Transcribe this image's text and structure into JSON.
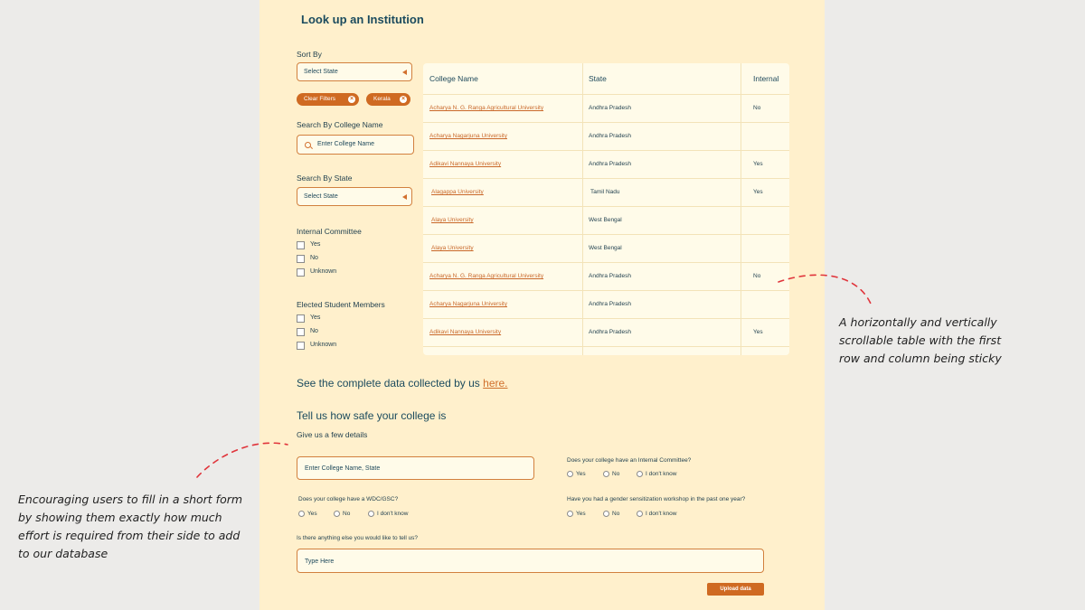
{
  "page": {
    "title": "Look up an Institution",
    "sort_by_label": "Sort By",
    "sort_select": "Select State",
    "chips": [
      {
        "label": "Clear Filters"
      },
      {
        "label": "Kerala"
      }
    ],
    "search_name_label": "Search By College Name",
    "search_name_placeholder": "Enter College Name",
    "search_state_label": "Search By State",
    "state_select": "Select State",
    "internal_committee_label": "Internal Committee",
    "internal_committee_options": [
      "Yes",
      "No",
      "Unknown"
    ],
    "elected_label": "Elected Student Members",
    "elected_options": [
      "Yes",
      "No",
      "Unknown"
    ]
  },
  "table": {
    "headers": [
      "College Name",
      "State",
      "Internal"
    ],
    "rows": [
      {
        "name": "Acharya N. G. Ranga Agricultural University",
        "state": "Andhra Pradesh",
        "internal": "No"
      },
      {
        "name": "Acharya Nagarjuna University",
        "state": "Andhra Pradesh",
        "internal": ""
      },
      {
        "name": "Adikavi Nannaya University",
        "state": "Andhra Pradesh",
        "internal": "Yes"
      },
      {
        "name": "Alagappa University",
        "state": "Tamil Nadu",
        "internal": "Yes"
      },
      {
        "name": "Alaya University",
        "state": "West Bengal",
        "internal": ""
      },
      {
        "name": "Alaya University",
        "state": "West Bengal",
        "internal": ""
      },
      {
        "name": "Acharya N. G. Ranga Agricultural University",
        "state": "Andhra Pradesh",
        "internal": "No"
      },
      {
        "name": "Acharya Nagarjuna University",
        "state": "Andhra Pradesh",
        "internal": ""
      },
      {
        "name": "Adikavi Nannaya University",
        "state": "Andhra Pradesh",
        "internal": "Yes"
      }
    ]
  },
  "complete_data": {
    "text": "See the complete data collected by us ",
    "link": "here."
  },
  "form": {
    "heading": "Tell us how safe your college is",
    "subheading": "Give us a few details",
    "college_placeholder": "Enter College Name, State",
    "q_internal": "Does your college have an Internal Committee?",
    "q_wdc": "Does your college have a WDC/GSC?",
    "q_workshop": "Have you had a gender sensitization workshop in the past one year?",
    "options": [
      "Yes",
      "No",
      "I don't know"
    ],
    "q_anything": "Is there anything else you would like to tell us?",
    "textarea_placeholder": "Type Here",
    "submit": "Upload data"
  },
  "annotations": {
    "right": "A horizontally and vertically scrollable table with the first row and column being sticky",
    "left": "Encouraging users to fill in a short form by showing them exactly how much effort is required from their side to add to our database"
  },
  "colors": {
    "accent": "#cf6a22",
    "panel": "#fff0cc",
    "text": "#1b4b5e",
    "annotation_line": "#e0343b"
  }
}
